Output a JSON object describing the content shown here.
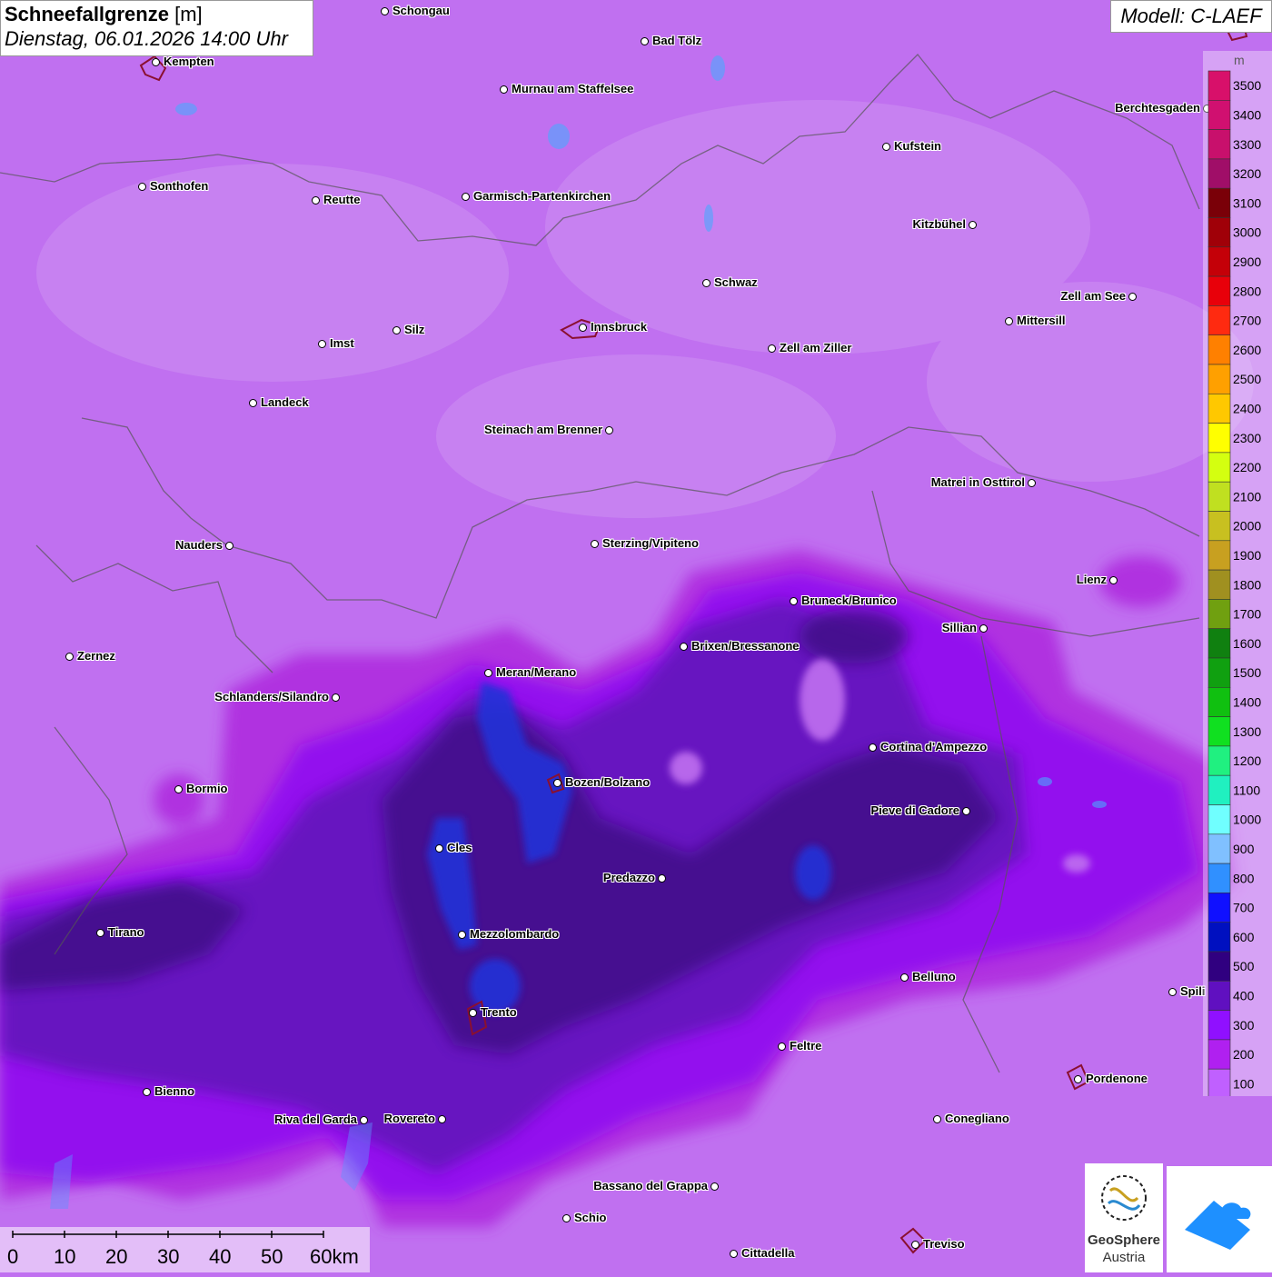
{
  "header": {
    "title": "Schneefallgrenze",
    "unit": "[m]",
    "datetime": "Dienstag, 06.01.2026 14:00 Uhr",
    "model": "Modell: C-LAEF"
  },
  "legend": {
    "unit": "m",
    "levels": [
      {
        "label": "3500",
        "color": "#d8106a"
      },
      {
        "label": "3400",
        "color": "#d01070"
      },
      {
        "label": "3300",
        "color": "#c8106c"
      },
      {
        "label": "3200",
        "color": "#a00e68"
      },
      {
        "label": "3100",
        "color": "#7a0008"
      },
      {
        "label": "3000",
        "color": "#a00008"
      },
      {
        "label": "2900",
        "color": "#c40008"
      },
      {
        "label": "2800",
        "color": "#e8000a"
      },
      {
        "label": "2700",
        "color": "#ff2a10"
      },
      {
        "label": "2600",
        "color": "#ff8000"
      },
      {
        "label": "2500",
        "color": "#ffa000"
      },
      {
        "label": "2400",
        "color": "#ffc800"
      },
      {
        "label": "2300",
        "color": "#ffff00"
      },
      {
        "label": "2200",
        "color": "#d4ff10"
      },
      {
        "label": "2100",
        "color": "#c0e020"
      },
      {
        "label": "2000",
        "color": "#c8c020"
      },
      {
        "label": "1900",
        "color": "#c8a020"
      },
      {
        "label": "1800",
        "color": "#a09020"
      },
      {
        "label": "1700",
        "color": "#70a010"
      },
      {
        "label": "1600",
        "color": "#108010"
      },
      {
        "label": "1500",
        "color": "#10a010"
      },
      {
        "label": "1400",
        "color": "#10c010"
      },
      {
        "label": "1300",
        "color": "#10e020"
      },
      {
        "label": "1200",
        "color": "#20f080"
      },
      {
        "label": "1100",
        "color": "#20f0c0"
      },
      {
        "label": "1000",
        "color": "#70ffff"
      },
      {
        "label": "900",
        "color": "#80c0ff"
      },
      {
        "label": "800",
        "color": "#3090ff"
      },
      {
        "label": "700",
        "color": "#1010ff"
      },
      {
        "label": "600",
        "color": "#0010c0"
      },
      {
        "label": "500",
        "color": "#300080"
      },
      {
        "label": "400",
        "color": "#6010c0"
      },
      {
        "label": "300",
        "color": "#9010ff"
      },
      {
        "label": "200",
        "color": "#b020f0"
      },
      {
        "label": "100",
        "color": "#c060ff"
      }
    ]
  },
  "cities": [
    {
      "name": "Schongau"
    },
    {
      "name": "Bad Tölz"
    },
    {
      "name": "Kempten"
    },
    {
      "name": "Murnau am Staffelsee"
    },
    {
      "name": "Berchtesgaden"
    },
    {
      "name": "Kufstein"
    },
    {
      "name": "Sonthofen"
    },
    {
      "name": "Reutte"
    },
    {
      "name": "Garmisch-Partenkirchen"
    },
    {
      "name": "Kitzbühel"
    },
    {
      "name": "Schwaz"
    },
    {
      "name": "Zell am See"
    },
    {
      "name": "Innsbruck"
    },
    {
      "name": "Mittersill"
    },
    {
      "name": "Silz"
    },
    {
      "name": "Imst"
    },
    {
      "name": "Zell am Ziller"
    },
    {
      "name": "Landeck"
    },
    {
      "name": "Steinach am Brenner"
    },
    {
      "name": "Matrei in Osttirol"
    },
    {
      "name": "Nauders"
    },
    {
      "name": "Sterzing/Vipiteno"
    },
    {
      "name": "Lienz"
    },
    {
      "name": "Bruneck/Brunico"
    },
    {
      "name": "Sillian"
    },
    {
      "name": "Brixen/Bressanone"
    },
    {
      "name": "Zernez"
    },
    {
      "name": "Meran/Merano"
    },
    {
      "name": "Schlanders/Silandro"
    },
    {
      "name": "Cortina d'Ampezzo"
    },
    {
      "name": "Bozen/Bolzano"
    },
    {
      "name": "Bormio"
    },
    {
      "name": "Pieve di Cadore"
    },
    {
      "name": "Cles"
    },
    {
      "name": "Predazzo"
    },
    {
      "name": "Tirano"
    },
    {
      "name": "Mezzolombardo"
    },
    {
      "name": "Belluno"
    },
    {
      "name": "Spili"
    },
    {
      "name": "Trento"
    },
    {
      "name": "Feltre"
    },
    {
      "name": "Pordenone"
    },
    {
      "name": "Bienno"
    },
    {
      "name": "Riva del Garda"
    },
    {
      "name": "Rovereto"
    },
    {
      "name": "Conegliano"
    },
    {
      "name": "Bassano del Grappa"
    },
    {
      "name": "Schio"
    },
    {
      "name": "Treviso"
    },
    {
      "name": "Cittadella"
    }
  ],
  "scale": {
    "labels": [
      "0",
      "10",
      "20",
      "30",
      "40",
      "50",
      "60km"
    ]
  },
  "logos": {
    "geosphere_line1": "GeoSphere",
    "geosphere_line2": "Austria"
  }
}
